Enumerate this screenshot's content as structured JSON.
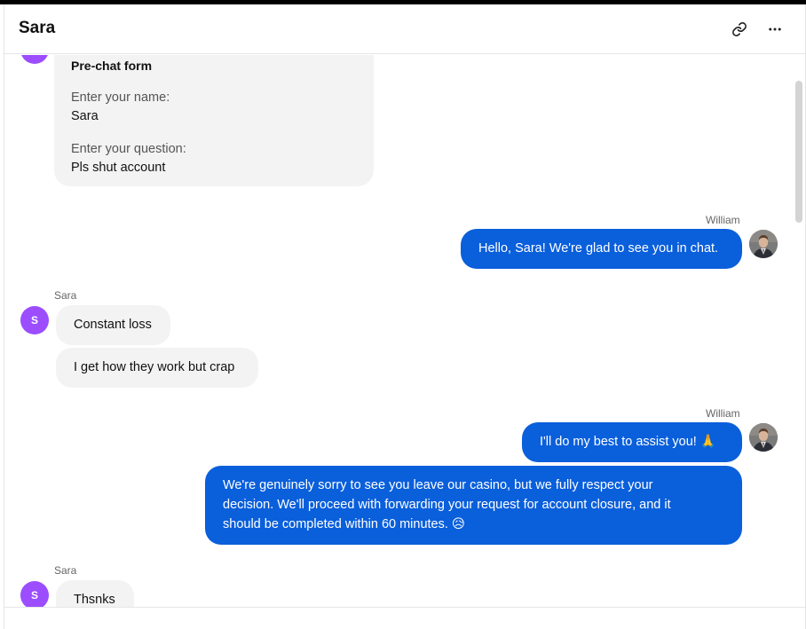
{
  "header": {
    "title": "Sara",
    "link_icon": "link-icon",
    "more_icon": "more-horizontal-icon"
  },
  "prechat": {
    "title": "Pre-chat form",
    "name_label": "Enter your name:",
    "name_value": "Sara",
    "question_label": "Enter your question:",
    "question_value": "Pls shut account"
  },
  "agent": {
    "name": "William"
  },
  "visitor": {
    "name": "Sara",
    "initial": "S"
  },
  "messages": {
    "m1": "Hello, Sara! We're glad to see you in chat.",
    "m2": "Constant loss",
    "m3": "I get how they work but crap",
    "m4": "I'll do my best to assist you! 🙏",
    "m5_line1": "We're genuinely sorry to see you leave our casino, but we fully respect your",
    "m5_line2": "decision. We'll proceed with forwarding your request for account closure, and it",
    "m5_line3": "should be completed within 60 minutes. 😥",
    "m6": "Thsnks"
  },
  "colors": {
    "agent_bubble": "#0a5fdb",
    "visitor_bubble": "#f3f3f3",
    "visitor_avatar": "#9b4dff"
  }
}
